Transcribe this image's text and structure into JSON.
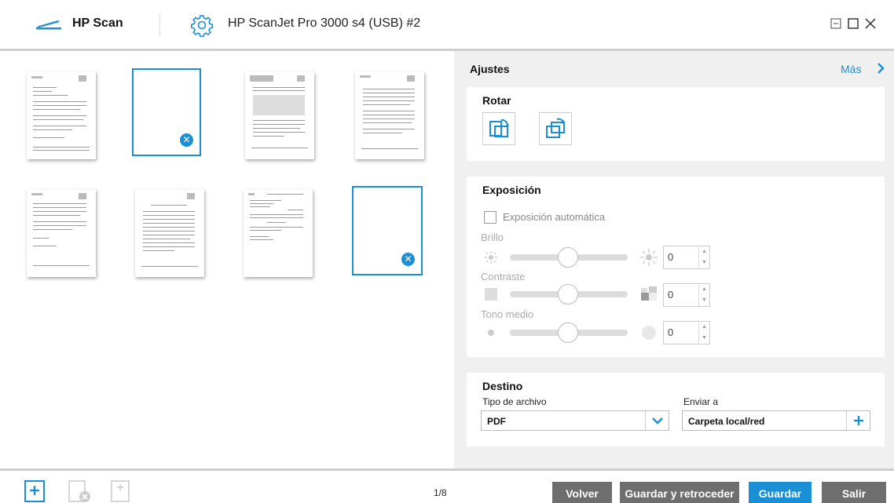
{
  "window": {
    "app_name": "HP Scan",
    "device_name": "HP ScanJet Pro 3000 s4 (USB) #2"
  },
  "settings": {
    "title": "Ajustes",
    "more_label": "Más",
    "rotate": {
      "title": "Rotar"
    },
    "exposure": {
      "title": "Exposición",
      "auto_label": "Exposición automática",
      "auto_checked": false,
      "brightness_label": "Brillo",
      "brightness_value": "0",
      "contrast_label": "Contraste",
      "contrast_value": "0",
      "midtone_label": "Tono medio",
      "midtone_value": "0"
    },
    "destination": {
      "title": "Destino",
      "file_type_label": "Tipo de archivo",
      "file_type_value": "PDF",
      "send_to_label": "Enviar a",
      "send_to_value": "Carpeta local/red"
    }
  },
  "thumbnails": [
    {
      "kind": "page",
      "selected": false
    },
    {
      "kind": "blank",
      "selected": true
    },
    {
      "kind": "page",
      "selected": false
    },
    {
      "kind": "page",
      "selected": false
    },
    {
      "kind": "page",
      "selected": false
    },
    {
      "kind": "page",
      "selected": false
    },
    {
      "kind": "page",
      "selected": false
    },
    {
      "kind": "blank",
      "selected": true
    }
  ],
  "bottom": {
    "page_count": "1/8",
    "back_label": "Volver",
    "save_back_label": "Guardar y retroceder",
    "save_label": "Guardar",
    "exit_label": "Salir"
  },
  "colors": {
    "accent": "#1a8fd6",
    "button_grey": "#6e6e6e",
    "panel_bg": "#f0f0f0"
  }
}
